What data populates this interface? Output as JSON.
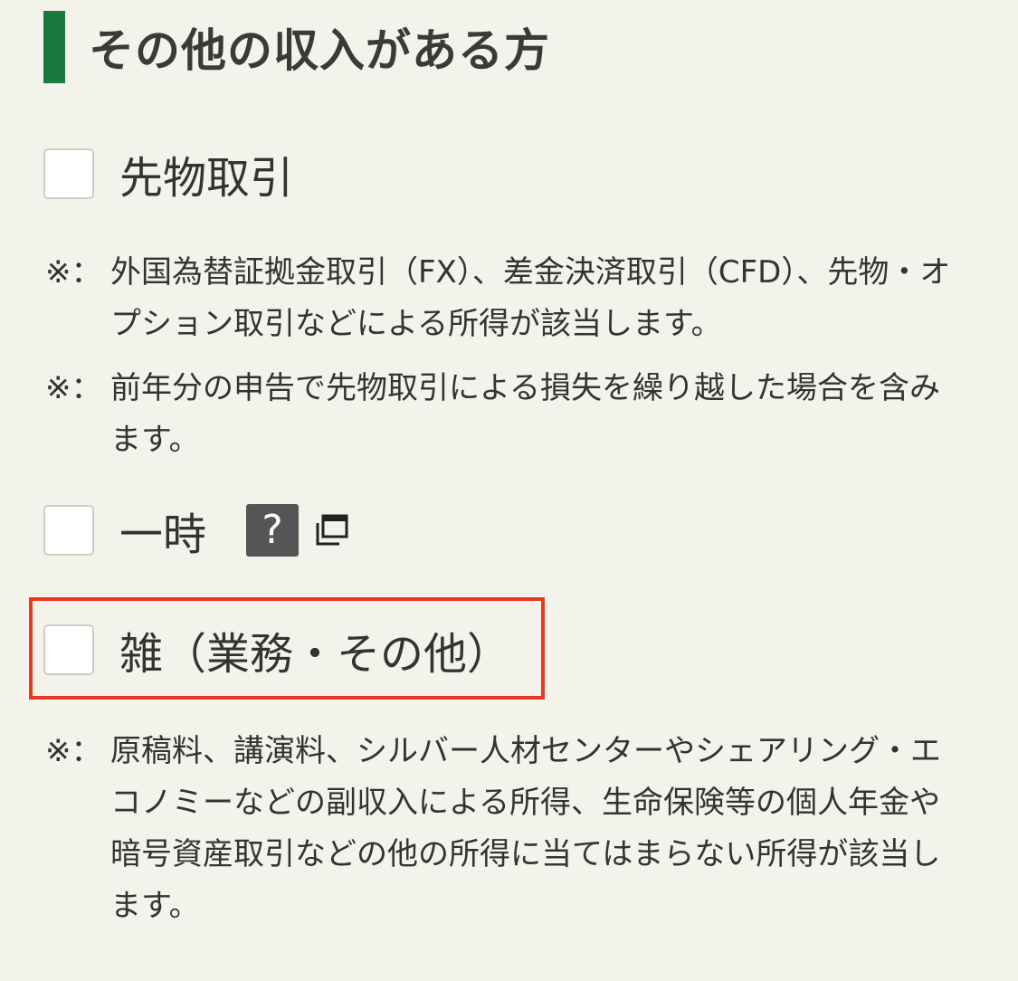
{
  "header": {
    "title": "その他の収入がある方",
    "accent_color": "#1a7a3e"
  },
  "options": [
    {
      "id": "futures",
      "label": "先物取引",
      "checked": false,
      "notes": [
        {
          "mark": "※：",
          "text": "外国為替証拠金取引（FX）、差金決済取引（CFD）、先物・オプション取引などによる所得が該当します。"
        },
        {
          "mark": "※：",
          "text": "前年分の申告で先物取引による損失を繰り越した場合を含みます。"
        }
      ]
    },
    {
      "id": "temporary",
      "label": "一時",
      "checked": false,
      "help_icon": "question-mark-icon",
      "help_glyph": "?",
      "new_window_icon": "new-window-icon"
    },
    {
      "id": "misc",
      "label": "雑（業務・その他）",
      "checked": false,
      "highlighted": true,
      "highlight_color": "#e8391e",
      "notes": [
        {
          "mark": "※：",
          "text": "原稿料、講演料、シルバー人材センターやシェアリング・エコノミーなどの副収入による所得、生命保険等の個人年金や暗号資産取引などの他の所得に当てはまらない所得が該当します。"
        }
      ]
    }
  ]
}
